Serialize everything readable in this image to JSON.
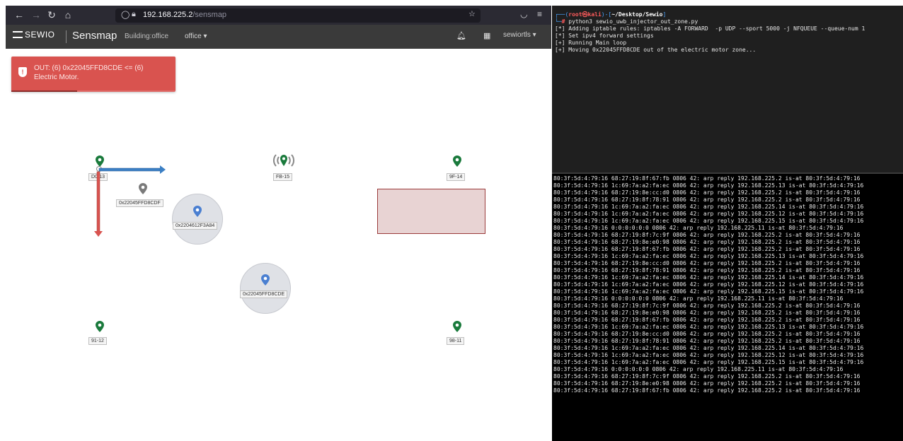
{
  "browser": {
    "url_host": "192.168.225.2",
    "url_path": "/sensmap",
    "icons": [
      "back-arrow-icon",
      "forward-arrow-icon",
      "reload-icon",
      "home-icon",
      "shield-icon",
      "lock-icon",
      "star-icon",
      "pocket-icon",
      "menu-icon"
    ]
  },
  "app": {
    "logo": "SEWIO",
    "name": "Sensmap",
    "building_label": "Building:office",
    "office_dropdown": "office",
    "username": "sewiortls",
    "icons": [
      "bell-icon",
      "grid-icon"
    ]
  },
  "alert": {
    "text": "OUT: (6) 0x22045FFD8CDE <= (6) Electric Motor.",
    "color": "#d9534f",
    "progress": 0.4
  },
  "anchors": [
    {
      "id": "D0-13",
      "color": "#1a7a3c"
    },
    {
      "id": "FB-15",
      "color": "#1a7a3c"
    },
    {
      "id": "9F-14",
      "color": "#1a7a3c"
    },
    {
      "id": "91-12",
      "color": "#1a7a3c"
    },
    {
      "id": "98-11",
      "color": "#1a7a3c"
    }
  ],
  "tags": [
    {
      "id": "0x22045FFD8CDF",
      "color": "#7a7a7a"
    },
    {
      "id": "0x2204612F3A84",
      "color": "#4a7fd1"
    },
    {
      "id": "0x22045FFD8CDE",
      "color": "#4a7fd1"
    }
  ],
  "zone_color": "#d9b5b5",
  "terminal": {
    "prompt_user": "root㉿kali",
    "prompt_path": "~/Desktop/Sewio",
    "command": "python3 sewio_uwb_injector_out_zone.py",
    "output": [
      "[*] Adding iptable rules: iptables -A FORWARD  -p UDP --sport 5000 -j NFQUEUE --queue-num 1",
      "[*] Set ipv4 forward settings",
      "[+] Running Main loop",
      "[+] Moving 0x22045FFD8CDE out of the electric motor zone..."
    ],
    "arp_lines": [
      "80:3f:5d:4:79:16 68:27:19:8f:67:fb 0806 42: arp reply 192.168.225.2 is-at 80:3f:5d:4:79:16",
      "80:3f:5d:4:79:16 1c:69:7a:a2:fa:ec 0806 42: arp reply 192.168.225.13 is-at 80:3f:5d:4:79:16",
      "80:3f:5d:4:79:16 68:27:19:8e:cc:d0 0806 42: arp reply 192.168.225.2 is-at 80:3f:5d:4:79:16",
      "80:3f:5d:4:79:16 68:27:19:8f:78:91 0806 42: arp reply 192.168.225.2 is-at 80:3f:5d:4:79:16",
      "80:3f:5d:4:79:16 1c:69:7a:a2:fa:ec 0806 42: arp reply 192.168.225.14 is-at 80:3f:5d:4:79:16",
      "80:3f:5d:4:79:16 1c:69:7a:a2:fa:ec 0806 42: arp reply 192.168.225.12 is-at 80:3f:5d:4:79:16",
      "80:3f:5d:4:79:16 1c:69:7a:a2:fa:ec 0806 42: arp reply 192.168.225.15 is-at 80:3f:5d:4:79:16",
      "80:3f:5d:4:79:16 0:0:0:0:0:0 0806 42: arp reply 192.168.225.11 is-at 80:3f:5d:4:79:16",
      "80:3f:5d:4:79:16 68:27:19:8f:7c:9f 0806 42: arp reply 192.168.225.2 is-at 80:3f:5d:4:79:16",
      "80:3f:5d:4:79:16 68:27:19:8e:e0:98 0806 42: arp reply 192.168.225.2 is-at 80:3f:5d:4:79:16",
      "80:3f:5d:4:79:16 68:27:19:8f:67:fb 0806 42: arp reply 192.168.225.2 is-at 80:3f:5d:4:79:16",
      "80:3f:5d:4:79:16 1c:69:7a:a2:fa:ec 0806 42: arp reply 192.168.225.13 is-at 80:3f:5d:4:79:16",
      "80:3f:5d:4:79:16 68:27:19:8e:cc:d0 0806 42: arp reply 192.168.225.2 is-at 80:3f:5d:4:79:16",
      "80:3f:5d:4:79:16 68:27:19:8f:78:91 0806 42: arp reply 192.168.225.2 is-at 80:3f:5d:4:79:16",
      "80:3f:5d:4:79:16 1c:69:7a:a2:fa:ec 0806 42: arp reply 192.168.225.14 is-at 80:3f:5d:4:79:16",
      "80:3f:5d:4:79:16 1c:69:7a:a2:fa:ec 0806 42: arp reply 192.168.225.12 is-at 80:3f:5d:4:79:16",
      "80:3f:5d:4:79:16 1c:69:7a:a2:fa:ec 0806 42: arp reply 192.168.225.15 is-at 80:3f:5d:4:79:16",
      "80:3f:5d:4:79:16 0:0:0:0:0:0 0806 42: arp reply 192.168.225.11 is-at 80:3f:5d:4:79:16",
      "80:3f:5d:4:79:16 68:27:19:8f:7c:9f 0806 42: arp reply 192.168.225.2 is-at 80:3f:5d:4:79:16",
      "80:3f:5d:4:79:16 68:27:19:8e:e0:98 0806 42: arp reply 192.168.225.2 is-at 80:3f:5d:4:79:16",
      "80:3f:5d:4:79:16 68:27:19:8f:67:fb 0806 42: arp reply 192.168.225.2 is-at 80:3f:5d:4:79:16",
      "80:3f:5d:4:79:16 1c:69:7a:a2:fa:ec 0806 42: arp reply 192.168.225.13 is-at 80:3f:5d:4:79:16",
      "80:3f:5d:4:79:16 68:27:19:8e:cc:d0 0806 42: arp reply 192.168.225.2 is-at 80:3f:5d:4:79:16",
      "80:3f:5d:4:79:16 68:27:19:8f:78:91 0806 42: arp reply 192.168.225.2 is-at 80:3f:5d:4:79:16",
      "80:3f:5d:4:79:16 1c:69:7a:a2:fa:ec 0806 42: arp reply 192.168.225.14 is-at 80:3f:5d:4:79:16",
      "80:3f:5d:4:79:16 1c:69:7a:a2:fa:ec 0806 42: arp reply 192.168.225.12 is-at 80:3f:5d:4:79:16",
      "80:3f:5d:4:79:16 1c:69:7a:a2:fa:ec 0806 42: arp reply 192.168.225.15 is-at 80:3f:5d:4:79:16",
      "80:3f:5d:4:79:16 0:0:0:0:0:0 0806 42: arp reply 192.168.225.11 is-at 80:3f:5d:4:79:16",
      "80:3f:5d:4:79:16 68:27:19:8f:7c:9f 0806 42: arp reply 192.168.225.2 is-at 80:3f:5d:4:79:16",
      "80:3f:5d:4:79:16 68:27:19:8e:e0:98 0806 42: arp reply 192.168.225.2 is-at 80:3f:5d:4:79:16",
      "80:3f:5d:4:79:16 68:27:19:8f:67:fb 0806 42: arp reply 192.168.225.2 is-at 80:3f:5d:4:79:16"
    ]
  }
}
